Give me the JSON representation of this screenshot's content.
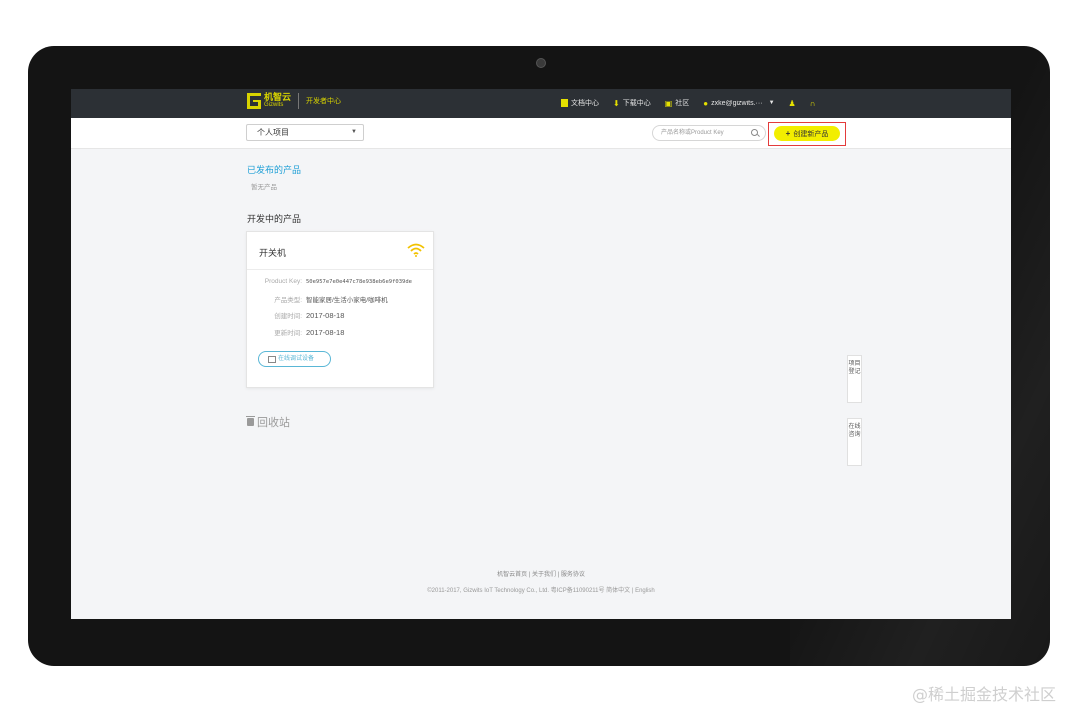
{
  "topnav": {
    "logo_cn": "机智云",
    "logo_en": "Gizwits",
    "dev_center": "开发者中心",
    "docs": "文档中心",
    "download": "下载中心",
    "community": "社区",
    "user": "zxke@gizwits.···"
  },
  "toolbar": {
    "project_select": "个人项目",
    "search_placeholder": "产品名称或Product Key",
    "create_button": "创建新产品"
  },
  "published": {
    "title": "已发布的产品",
    "empty": "暂无产品"
  },
  "developing": {
    "title": "开发中的产品",
    "card": {
      "name": "开关机",
      "product_key_label": "Product Key:",
      "product_key": "50e957e7e0e447c78e938eb6e9f039de",
      "type_label": "产品类型:",
      "type": "智能家居/生活小家电/咖啡机",
      "created_label": "创建时间:",
      "created": "2017-08-18",
      "updated_label": "更新时间:",
      "updated": "2017-08-18",
      "debug_button": "在线调试设备"
    }
  },
  "recycle": "回收站",
  "side_tabs": {
    "project_register": "项目登记",
    "online_debug": "在线咨询"
  },
  "footer": {
    "links": "机智云首页 | 关于我们 | 服务协议",
    "copyright": "©2011-2017, Gizwits IoT Technology Co., Ltd. 粤ICP备11090211号 简体中文 | English"
  },
  "watermark": "@稀土掘金技术社区",
  "colors": {
    "brand_yellow": "#f2ee00",
    "link_blue": "#1e9fd6",
    "highlight_red": "#e33b3b",
    "nav_bg": "#2c3035"
  }
}
